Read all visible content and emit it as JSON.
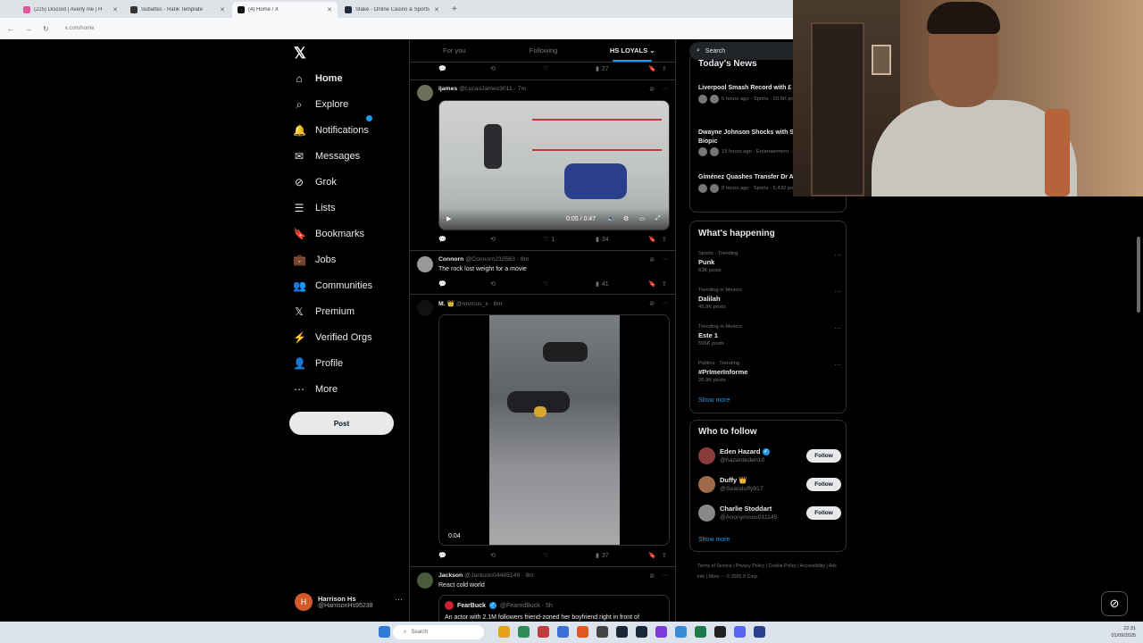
{
  "browser": {
    "tabs": [
      {
        "title": "(225) Discord | Averly me | H",
        "color": "#e0579b",
        "active": false
      },
      {
        "title": "Subattec - Rank Template",
        "color": "#333333",
        "active": false
      },
      {
        "title": "(4) Home / X",
        "color": "#111111",
        "active": true
      },
      {
        "title": "Stake - Online Casino & Sports",
        "color": "#1d2b3a",
        "active": false
      }
    ],
    "new_tab": "+",
    "url": "x.com/home"
  },
  "nav": {
    "logo": "𝕏",
    "items": [
      {
        "name": "home",
        "label": "Home",
        "icon": "⌂"
      },
      {
        "name": "explore",
        "label": "Explore",
        "icon": "⌕"
      },
      {
        "name": "notifications",
        "label": "Notifications",
        "icon": "🔔"
      },
      {
        "name": "messages",
        "label": "Messages",
        "icon": "✉"
      },
      {
        "name": "grok",
        "label": "Grok",
        "icon": "⊘"
      },
      {
        "name": "lists",
        "label": "Lists",
        "icon": "☰"
      },
      {
        "name": "bookmarks",
        "label": "Bookmarks",
        "icon": "🔖"
      },
      {
        "name": "jobs",
        "label": "Jobs",
        "icon": "💼"
      },
      {
        "name": "communities",
        "label": "Communities",
        "icon": "👥"
      },
      {
        "name": "premium",
        "label": "Premium",
        "icon": "𝕏"
      },
      {
        "name": "verified-orgs",
        "label": "Verified Orgs",
        "icon": "⚡"
      },
      {
        "name": "profile",
        "label": "Profile",
        "icon": "👤"
      },
      {
        "name": "more",
        "label": "More",
        "icon": "⋯"
      }
    ],
    "post_label": "Post",
    "account": {
      "initial": "H",
      "name": "Harrison Hs",
      "handle": "@HarrisonHs95238",
      "more": "···"
    }
  },
  "feed": {
    "tabs": [
      "For you",
      "Following",
      "HS LOYALS ⌄"
    ],
    "top_actions": {
      "likes": "",
      "views": "27"
    },
    "tweets": [
      {
        "author": "ljames",
        "handle": "@LucasJames3011 · 7m",
        "text": "",
        "video": {
          "time": "0:05 / 0:47"
        },
        "likes": "1",
        "views": "34"
      },
      {
        "author": "Connorn",
        "handle": "@Connorn232563 · 8m",
        "text": "The rock lost weight for a movie",
        "views": "41"
      },
      {
        "author": "M. 👑",
        "handle": "@mvrcus_x · 8m",
        "text": "",
        "video": {
          "time": "0:04"
        },
        "views": "37"
      },
      {
        "author": "Jackson",
        "handle": "@Jackson04485149 · 9m",
        "text": "React  cold world",
        "quote": {
          "author": "FearBuck",
          "handle": "@FearedBuck · 5h",
          "text": "An actor with 2.1M followers friend-zoned her boyfriend right in front of"
        }
      }
    ]
  },
  "right": {
    "search_placeholder": "Search",
    "news": {
      "title": "Today's News",
      "items": [
        {
          "title": "Liverpool Smash Record with £ Signing",
          "meta": "6 hours ago · Sports · 20.5K posts"
        },
        {
          "title": "Dwayne Johnson Shocks with Shift for MMA Biopic",
          "meta": "15 hours ago · Entertainment"
        },
        {
          "title": "Giménez Quashes Transfer Dr AC Milan",
          "meta": "8 hours ago · Sports · 6,432 posts"
        }
      ]
    },
    "trends": {
      "title": "What's happening",
      "items": [
        {
          "ctx": "Sports · Trending",
          "name": "Punk",
          "count": "63K posts"
        },
        {
          "ctx": "Trending in Mexico",
          "name": "Dalilah",
          "count": "45.9K posts"
        },
        {
          "ctx": "Trending in Mexico",
          "name": "Este 1",
          "count": "596K posts"
        },
        {
          "ctx": "Politics · Trending",
          "name": "#PrImerInforme",
          "count": "26.9K posts"
        }
      ],
      "show_more": "Show more"
    },
    "who_to_follow": {
      "title": "Who to follow",
      "items": [
        {
          "name": "Eden Hazard",
          "handle": "@hazardeden10",
          "verified": true,
          "color": "#8a3b3b"
        },
        {
          "name": "Duffy 👑",
          "handle": "@Seanduffy917",
          "verified": false,
          "color": "#a06a4a"
        },
        {
          "name": "Charlie Stoddart",
          "handle": "@Anonymous011145",
          "verified": false,
          "color": "#888888"
        }
      ],
      "follow_label": "Follow",
      "show_more": "Show more"
    },
    "footer": "Terms of Service  |  Privacy Policy  |  Cookie Policy  |  Accessibility  |  Ads info  |  More ···  © 2025 X Corp."
  },
  "taskbar": {
    "search": "Search",
    "time": "22:31",
    "date": "01/09/2025"
  }
}
